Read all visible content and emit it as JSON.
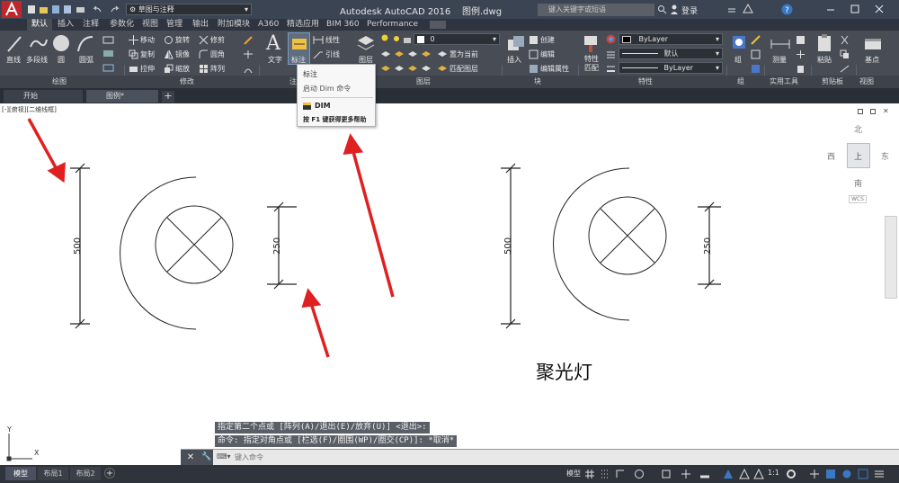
{
  "app": {
    "title": "Autodesk AutoCAD 2016",
    "filename": "图例.dwg",
    "workspace": "草图与注释",
    "search_placeholder": "键入关键字或短语",
    "login_label": "登录"
  },
  "ribbon_tabs": [
    "默认",
    "插入",
    "注释",
    "参数化",
    "视图",
    "管理",
    "输出",
    "附加模块",
    "A360",
    "精选应用",
    "BIM 360",
    "Performance"
  ],
  "ribbon": {
    "draw_tools": [
      "直线",
      "多段线",
      "圆",
      "圆弧"
    ],
    "modify_tools": [
      "移动",
      "旋转",
      "修剪",
      "复制",
      "镜像",
      "圆角",
      "拉伸",
      "缩放",
      "阵列"
    ],
    "annotation": {
      "text_label": "文字",
      "dim_label": "标注",
      "linear_label": "线性",
      "leader_label": "引线"
    },
    "layers": {
      "label": "图层",
      "current_layer": "0",
      "set_current": "置为当前",
      "match_layer": "匹配图层"
    },
    "block": {
      "insert_label": "插入",
      "create": "创建",
      "edit": "编辑",
      "edit_attr": "编辑属性"
    },
    "properties": {
      "match_label": "特性匹配",
      "color": "ByLayer",
      "linetype": "默认",
      "lineweight": "ByLayer"
    },
    "group_label": "组",
    "measure_label": "测量",
    "paste_label": "粘贴",
    "base_label": "基点"
  },
  "panel_titles": [
    "绘图",
    "修改",
    "注释",
    "图层",
    "块",
    "特性",
    "组",
    "实用工具",
    "剪贴板",
    "视图"
  ],
  "doc_tabs": [
    "开始",
    "图例*"
  ],
  "viewport_label": "[-][俯视][二维线框]",
  "viewcube": {
    "north": "北",
    "south": "南",
    "east": "东",
    "west": "西",
    "top": "上",
    "wcs": "WCS"
  },
  "tooltip": {
    "title": "标注",
    "desc": "启动 Dim 命令",
    "command": "DIM",
    "help": "按 F1 键获得更多帮助"
  },
  "drawing": {
    "dim_large": "500",
    "dim_small": "250",
    "label": "聚光灯"
  },
  "command": {
    "history": [
      "指定第二个点或 [阵列(A)/退出(E)/放弃(U)] <退出>:",
      "命令: 指定对角点或 [栏选(F)/圈围(WP)/圈交(CP)]: *取消*"
    ],
    "placeholder": "键入命令"
  },
  "layout_tabs": [
    "模型",
    "布局1",
    "布局2"
  ],
  "status": {
    "model": "模型",
    "scale": "1:1"
  },
  "ucs": {
    "x": "X",
    "y": "Y"
  },
  "colors": {
    "accent": "#c0272d",
    "ribbon_bg": "#474c55",
    "arrow": "#e02020"
  }
}
